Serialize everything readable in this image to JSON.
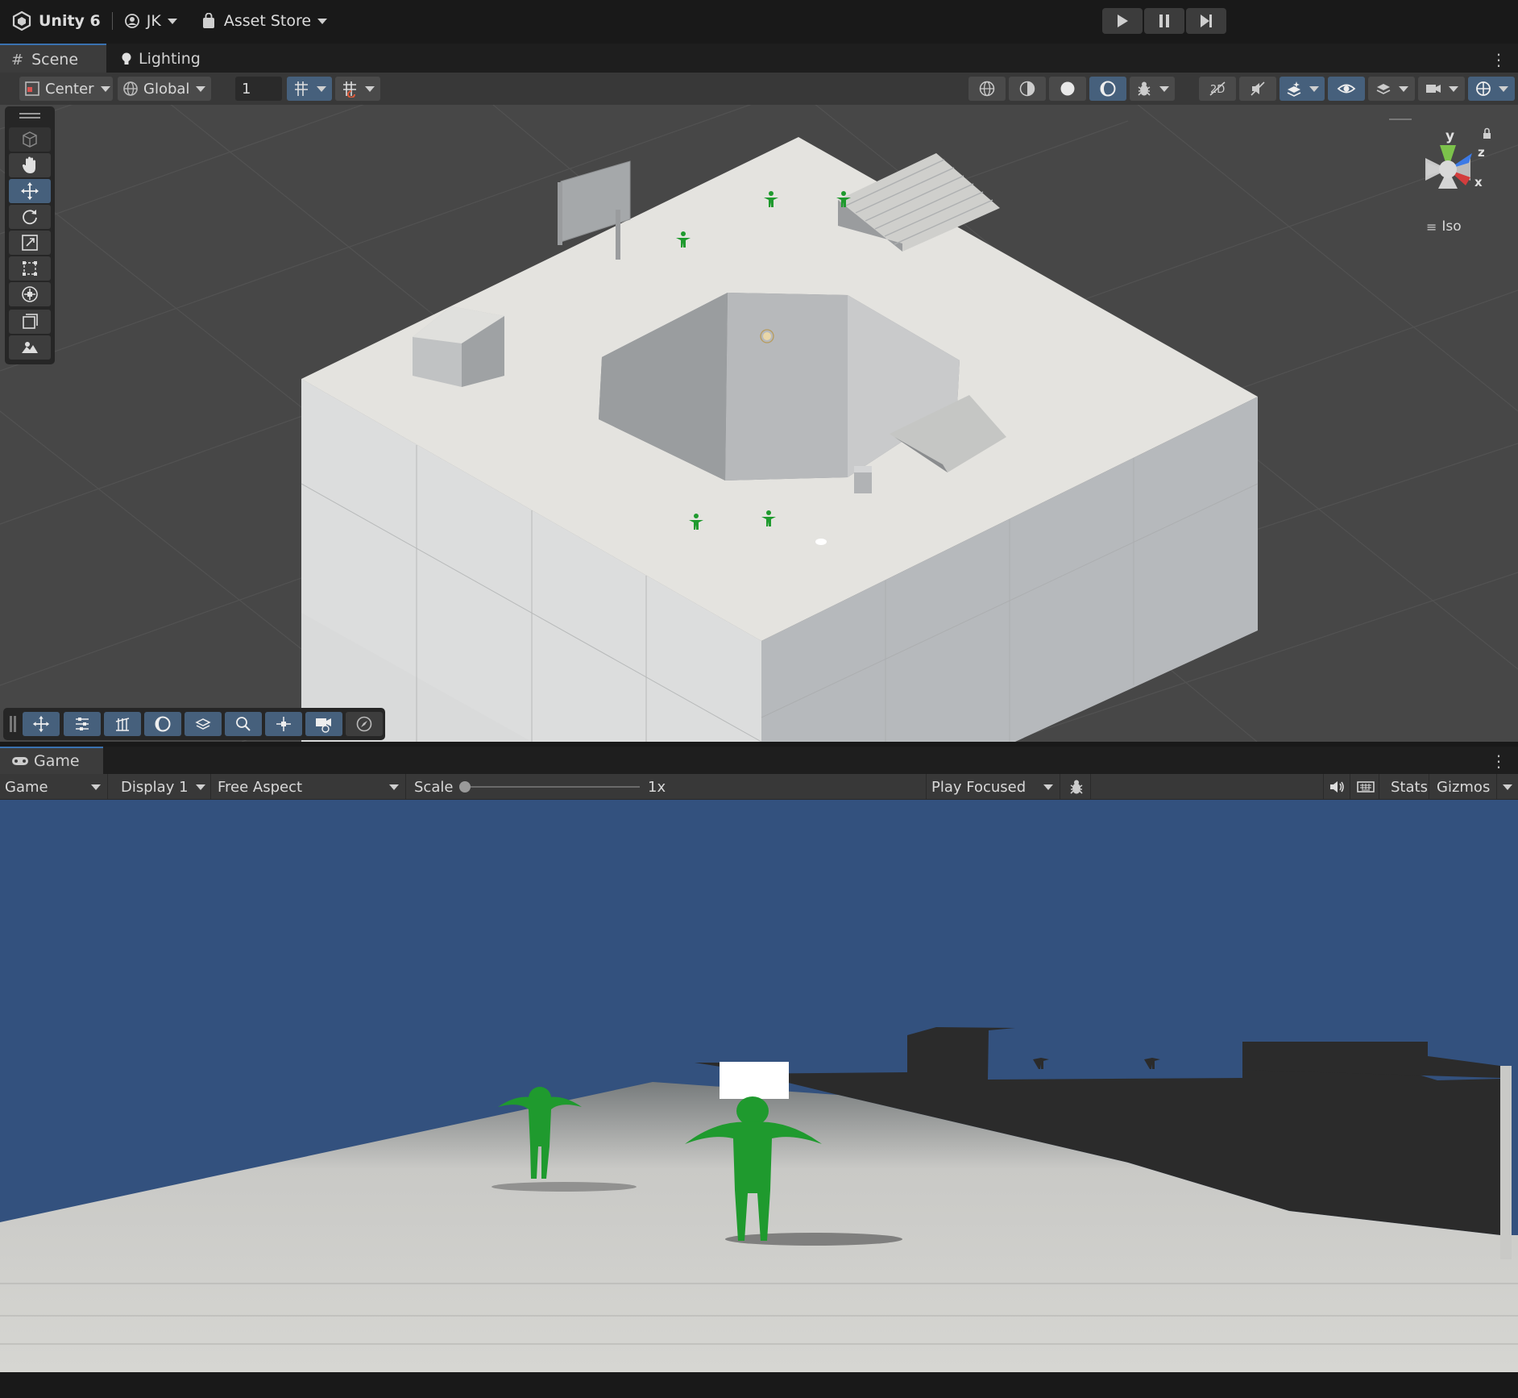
{
  "topbar": {
    "app_name": "Unity 6",
    "account_label": "JK",
    "asset_store_label": "Asset Store"
  },
  "scene_tabs": [
    {
      "label": "Scene",
      "active": true
    },
    {
      "label": "Lighting",
      "active": false
    }
  ],
  "scene_toolbar": {
    "pivot_label": "Center",
    "space_label": "Global",
    "grid_snap_value": "1"
  },
  "scene_gizmo": {
    "axis_y": "y",
    "axis_z": "z",
    "axis_x": "x",
    "projection_label": "Iso"
  },
  "game_tab": {
    "label": "Game"
  },
  "game_toolbar": {
    "view_label": "Game",
    "display_label": "Display 1",
    "aspect_label": "Free Aspect",
    "scale_label": "Scale",
    "scale_value": "1x",
    "play_mode_label": "Play Focused",
    "stats_label": "Stats",
    "gizmos_label": "Gizmos"
  },
  "colors": {
    "accent": "#46607c",
    "scene_background": "#474747",
    "game_sky": "#33517e",
    "character_green": "#1f9a2e"
  }
}
